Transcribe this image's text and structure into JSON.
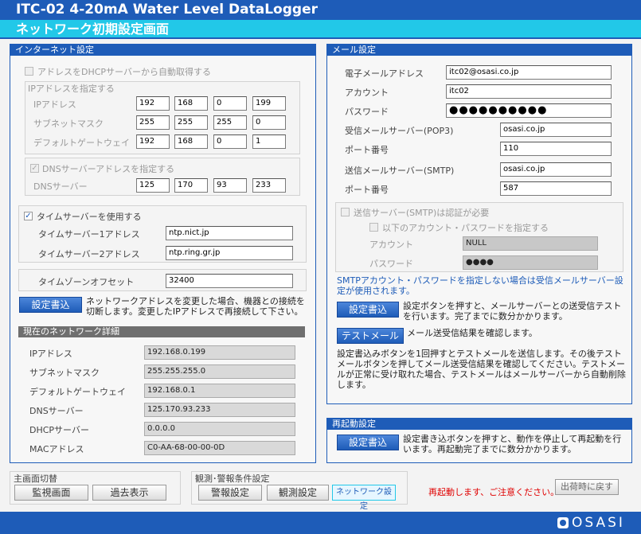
{
  "app": {
    "title": "ITC-02 4-20mA Water Level DataLogger",
    "page_title": "ネットワーク初期設定画面"
  },
  "internet": {
    "header": "インターネット設定",
    "dhcp_label": "アドレスをDHCPサーバーから自動取得する",
    "ip_group_label": "IPアドレスを指定する",
    "ip_label": "IPアドレス",
    "ip": [
      "192",
      "168",
      "0",
      "199"
    ],
    "mask_label": "サブネットマスク",
    "mask": [
      "255",
      "255",
      "255",
      "0"
    ],
    "gw_label": "デフォルトゲートウェイ",
    "gw": [
      "192",
      "168",
      "0",
      "1"
    ],
    "dns_check_label": "DNSサーバーアドレスを指定する",
    "dns_label": "DNSサーバー",
    "dns": [
      "125",
      "170",
      "93",
      "233"
    ],
    "time_check": "✓",
    "time_label": "タイムサーバーを使用する",
    "ts1_label": "タイムサーバー1アドレス",
    "ts1": "ntp.nict.jp",
    "ts2_label": "タイムサーバー2アドレス",
    "ts2": "ntp.ring.gr.jp",
    "tz_label": "タイムゾーンオフセット",
    "tz": "32400",
    "save_label": "設定書込",
    "save_desc": "ネットワークアドレスを変更した場合、機器との接続を切断します。変更したIPアドレスで再接続して下さい。"
  },
  "current": {
    "header": "現在のネットワーク詳細",
    "rows": [
      {
        "label": "IPアドレス",
        "value": "192.168.0.199"
      },
      {
        "label": "サブネットマスク",
        "value": "255.255.255.0"
      },
      {
        "label": "デフォルトゲートウェイ",
        "value": "192.168.0.1"
      },
      {
        "label": "DNSサーバー",
        "value": "125.170.93.233"
      },
      {
        "label": "DHCPサーバー",
        "value": "0.0.0.0"
      },
      {
        "label": "MACアドレス",
        "value": "C0-AA-68-00-00-0D"
      }
    ]
  },
  "mail": {
    "header": "メール設定",
    "email_label": "電子メールアドレス",
    "email": "itc02@osasi.co.jp",
    "account_label": "アカウント",
    "account": "itc02",
    "password_label": "パスワード",
    "password": "●●●●●●●●●●",
    "pop3_label": "受信メールサーバー(POP3)",
    "pop3": "osasi.co.jp",
    "pop3_port_label": "ポート番号",
    "pop3_port": "110",
    "smtp_label": "送信メールサーバー(SMTP)",
    "smtp": "osasi.co.jp",
    "smtp_port_label": "ポート番号",
    "smtp_port": "587",
    "auth_label": "送信サーバー(SMTP)は認証が必要",
    "auth_sub_label": "以下のアカウント・パスワードを指定する",
    "auth_account_label": "アカウント",
    "auth_account": "NULL",
    "auth_password_label": "パスワード",
    "auth_password": "●●●●",
    "note": "SMTPアカウント・パスワードを指定しない場合は受信メールサーバー設定が使用されます。",
    "save_label": "設定書込",
    "save_desc": "設定ボタンを押すと、メールサーバーとの送受信テストを行います。完了までに数分かかります。",
    "test_label": "テストメール",
    "test_desc": "メール送受信結果を確認します。",
    "info": "設定書込みボタンを1回押すとテストメールを送信します。その後テストメールボタンを押してメール送受信結果を確認してください。テストメールが正常に受け取れた場合、テストメールはメールサーバーから自動削除します。"
  },
  "reboot": {
    "header": "再起動設定",
    "save_label": "設定書込",
    "desc": "設定書き込ボタンを押すと、動作を停止して再起動を行います。再起動完了までに数分かかります。"
  },
  "bottom": {
    "main_switch_label": "主画面切替",
    "monitor": "監視画面",
    "history": "過去表示",
    "cond_label": "観測･警報条件設定",
    "alarm": "警報設定",
    "observe": "観測設定",
    "network": "ネットワーク設定",
    "warning": "再起動します、ご注意ください。",
    "factory": "出荷時に戻す"
  },
  "footer": {
    "logo": "OSASI"
  },
  "colors": {
    "primary": "#1e5cb8",
    "accent": "#22c8e8",
    "warning": "#e00000"
  }
}
